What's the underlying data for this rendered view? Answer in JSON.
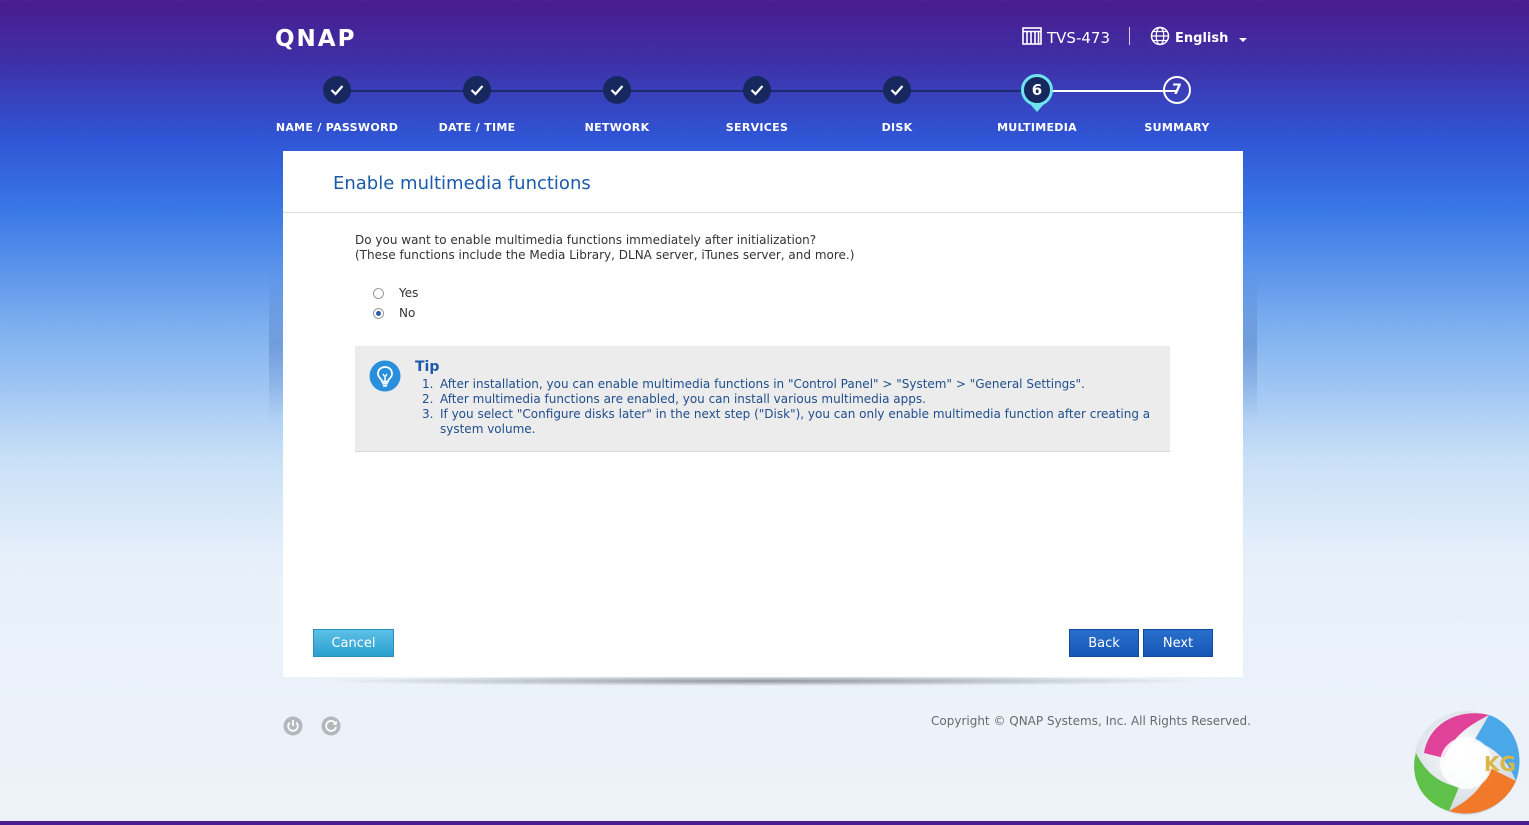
{
  "header": {
    "logo": "QNAP",
    "device_name": "TVS-473",
    "language": "English"
  },
  "steps": [
    {
      "label": "NAME / PASSWORD",
      "state": "done"
    },
    {
      "label": "DATE / TIME",
      "state": "done"
    },
    {
      "label": "NETWORK",
      "state": "done"
    },
    {
      "label": "SERVICES",
      "state": "done"
    },
    {
      "label": "DISK",
      "state": "done"
    },
    {
      "label": "MULTIMEDIA",
      "state": "current",
      "number": "6"
    },
    {
      "label": "SUMMARY",
      "state": "todo",
      "number": "7"
    }
  ],
  "panel": {
    "title": "Enable multimedia functions",
    "question_line1": "Do you want to enable multimedia functions immediately after initialization?",
    "question_line2": "(These functions include the Media Library, DLNA server, iTunes server, and more.)",
    "options": [
      {
        "label": "Yes",
        "checked": false
      },
      {
        "label": "No",
        "checked": true
      }
    ],
    "tip": {
      "title": "Tip",
      "items": [
        {
          "num": "1.",
          "text": "After installation, you can enable multimedia functions in \"Control Panel\" > \"System\" > \"General Settings\"."
        },
        {
          "num": "2.",
          "text": "After multimedia functions are enabled, you can install various multimedia apps."
        },
        {
          "num": "3.",
          "text": "If you select \"Configure disks later\" in the next step (\"Disk\"), you can only enable multimedia function after creating a system volume."
        }
      ]
    },
    "buttons": {
      "cancel": "Cancel",
      "back": "Back",
      "next": "Next"
    }
  },
  "footer": {
    "copyright": "Copyright © QNAP Systems, Inc. All Rights Reserved.",
    "icons": [
      "power-icon",
      "restart-icon"
    ]
  },
  "watermark": {
    "text": "KG"
  },
  "colors": {
    "accent_blue": "#1a5aa8",
    "step_done": "#17285f",
    "step_current_ring": "#6fe3f0",
    "button_primary": "#1656b4",
    "button_cancel": "#2a9fcf"
  }
}
